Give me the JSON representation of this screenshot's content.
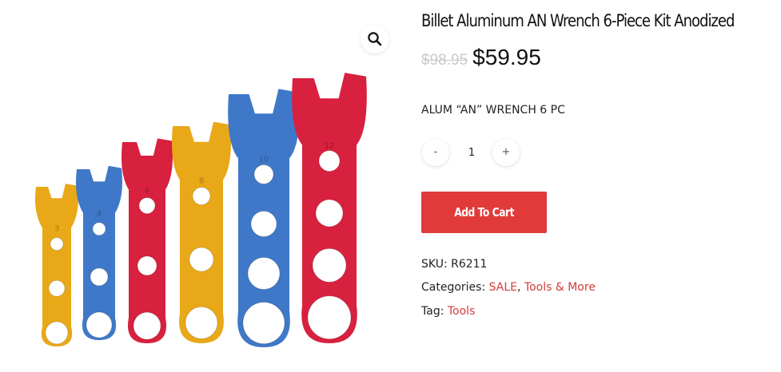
{
  "product": {
    "title": "Billet Aluminum AN Wrench 6-Piece Kit Anodized",
    "regular_price": "$98.95",
    "sale_price": "$59.95",
    "short_description": "ALUM “AN” WRENCH 6 PC"
  },
  "gallery": {
    "zoom_icon": "magnifier-icon",
    "wrench_sizes": [
      "3",
      "4",
      "6",
      "8",
      "10",
      "12"
    ],
    "wrench_colors": [
      "#e8a817",
      "#3f78c8",
      "#d8203f",
      "#e8a817",
      "#3f78c8",
      "#d8203f"
    ]
  },
  "quantity": {
    "minus_label": "-",
    "plus_label": "+",
    "value": "1"
  },
  "cart": {
    "add_label": "Add To Cart",
    "button_color": "#e03a3a"
  },
  "meta": {
    "sku_label": "SKU:",
    "sku_value": "R6211",
    "categories_label": "Categories:",
    "categories": [
      "SALE",
      "Tools & More"
    ],
    "separator": ",",
    "tag_label": "Tag:",
    "tags": [
      "Tools"
    ],
    "link_color": "#d33b3b"
  }
}
